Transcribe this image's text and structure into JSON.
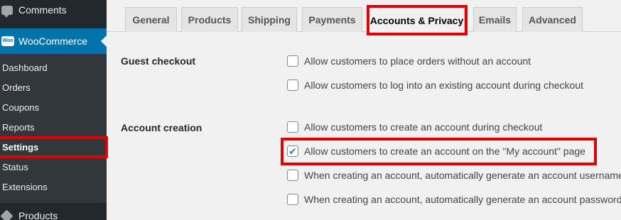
{
  "sidebar": {
    "comments_label": "Comments",
    "woocommerce_label": "WooCommerce",
    "woo_logo_text": "Woo",
    "submenu": [
      {
        "label": "Dashboard"
      },
      {
        "label": "Orders"
      },
      {
        "label": "Coupons"
      },
      {
        "label": "Reports"
      },
      {
        "label": "Settings",
        "active": true
      },
      {
        "label": "Status"
      },
      {
        "label": "Extensions"
      }
    ],
    "products_label": "Products"
  },
  "tabs": [
    {
      "label": "General"
    },
    {
      "label": "Products"
    },
    {
      "label": "Shipping"
    },
    {
      "label": "Payments"
    },
    {
      "label": "Accounts & Privacy",
      "active": true
    },
    {
      "label": "Emails"
    },
    {
      "label": "Advanced"
    }
  ],
  "guest_checkout": {
    "label": "Guest checkout",
    "options": [
      {
        "text": "Allow customers to place orders without an account",
        "checked": false
      },
      {
        "text": "Allow customers to log into an existing account during checkout",
        "checked": false
      }
    ]
  },
  "account_creation": {
    "label": "Account creation",
    "options": [
      {
        "text": "Allow customers to create an account during checkout",
        "checked": false
      },
      {
        "text": "Allow customers to create an account on the \"My account\" page",
        "checked": true
      },
      {
        "text": "When creating an account, automatically generate an account username",
        "checked": false
      },
      {
        "text": "When creating an account, automatically generate an account password",
        "checked": false
      }
    ]
  },
  "colors": {
    "sidebar_bg": "#23282d",
    "submenu_bg": "#32373c",
    "accent": "#0073aa",
    "highlight": "#e00000",
    "checkmark": "#1e8cbe"
  }
}
